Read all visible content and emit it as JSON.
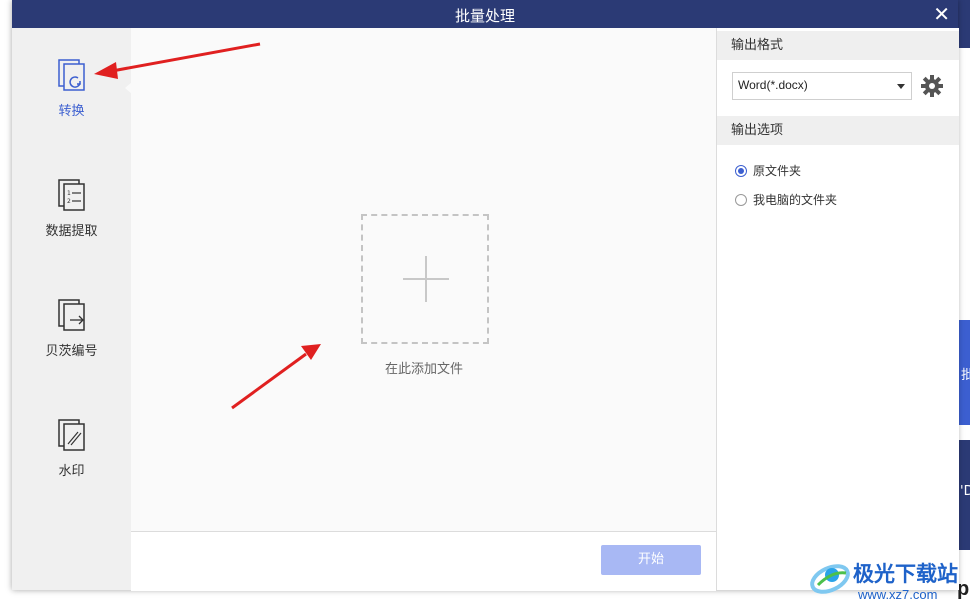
{
  "window": {
    "title": "批量处理",
    "close": "✕"
  },
  "sidebar": {
    "items": [
      {
        "label": "转换",
        "icon": "convert-icon",
        "active": true
      },
      {
        "label": "数据提取",
        "icon": "data-extract-icon",
        "active": false
      },
      {
        "label": "贝茨编号",
        "icon": "bates-number-icon",
        "active": false
      },
      {
        "label": "水印",
        "icon": "watermark-icon",
        "active": false
      }
    ]
  },
  "main": {
    "drop_label": "在此添加文件",
    "drop_icon": "plus-icon"
  },
  "footer": {
    "start_label": "开始"
  },
  "right": {
    "format_heading": "输出格式",
    "format_value": "Word(*.docx)",
    "options_heading": "输出选项",
    "options": [
      {
        "label": "原文件夹",
        "checked": true
      },
      {
        "label": "我电脑的文件夹",
        "checked": false
      }
    ]
  },
  "background": {
    "fragment_a": "批",
    "fragment_b": "'D",
    "fragment_c": "p"
  },
  "watermark": {
    "text": "极光下载站",
    "url": "www.xz7.com"
  },
  "colors": {
    "titlebar": "#2b3a75",
    "accent": "#3c5fd0",
    "start_disabled": "#a8b8f4",
    "annotation_arrow": "#e02020"
  }
}
